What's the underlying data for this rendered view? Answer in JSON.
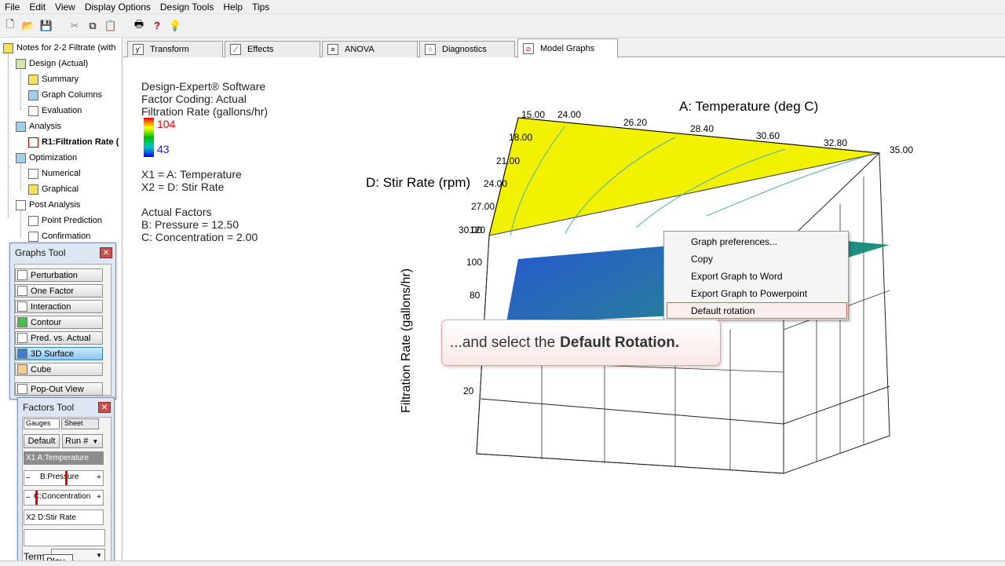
{
  "menu": [
    "File",
    "Edit",
    "View",
    "Display Options",
    "Design Tools",
    "Help",
    "Tips"
  ],
  "toolbar": [
    "new-icon",
    "open-icon",
    "save-icon",
    "cut-icon",
    "copy-icon",
    "paste-icon",
    "print-icon",
    "help-icon",
    "tip-icon"
  ],
  "tree": {
    "root": "Notes for 2-2 Filtrate (with",
    "design": "Design (Actual)",
    "summary": "Summary",
    "graph_columns": "Graph Columns",
    "evaluation": "Evaluation",
    "analysis": "Analysis",
    "r1": "R1:Filtration Rate (",
    "optimization": "Optimization",
    "numerical": "Numerical",
    "graphical": "Graphical",
    "post_analysis": "Post Analysis",
    "point_prediction": "Point Prediction",
    "confirmation": "Confirmation"
  },
  "tabs": [
    "Transform",
    "Effects",
    "ANOVA",
    "Diagnostics",
    "Model Graphs"
  ],
  "active_tab": "Model Graphs",
  "graph_info": {
    "software": "Design-Expert® Software",
    "coding": "Factor Coding: Actual",
    "response": "Filtration Rate (gallons/hr)",
    "high": "104",
    "low": "43",
    "x1": "X1 = A: Temperature",
    "x2": "X2 = D: Stir Rate",
    "actual_factors": "Actual Factors",
    "b": "B: Pressure = 12.50",
    "c": "C: Concentration = 2.00"
  },
  "chart_data": {
    "type": "3d-surface",
    "title_x": "A: Temperature (deg C)",
    "title_y": "D: Stir Rate (rpm)",
    "title_z": "Filtration Rate (gallons/hr)",
    "x_ticks": [
      "24.00",
      "26.20",
      "28.40",
      "30.60",
      "32.80",
      "35.00"
    ],
    "y_ticks": [
      "15.00",
      "18.00",
      "21.00",
      "24.00",
      "27.00",
      "30.00"
    ],
    "z_ticks": [
      "120",
      "100",
      "80",
      "20"
    ],
    "colors": {
      "high": "#ff0000",
      "low": "#0000ff",
      "surface_top": "#f2f200"
    }
  },
  "graphs_tool": {
    "title": "Graphs Tool",
    "buttons": [
      "Perturbation",
      "One Factor",
      "Interaction",
      "Contour",
      "Pred. vs. Actual",
      "3D Surface",
      "Cube"
    ],
    "popout": "Pop-Out View",
    "selected": "3D Surface"
  },
  "factors_tool": {
    "title": "Factors Tool",
    "gauges": "Gauges",
    "sheet": "Sheet",
    "default": "Default",
    "run": "Run #",
    "rows": [
      "X1  A:Temperature",
      "B:Pressure",
      "C:Concentration",
      "X2  D:Stir Rate"
    ],
    "minus": "–",
    "plus": "+",
    "term": "Term",
    "play": "Play"
  },
  "context_menu": {
    "items": [
      "Graph preferences...",
      "Copy",
      "Export Graph to Word",
      "Export Graph to Powerpoint",
      "Default rotation"
    ]
  },
  "callout": {
    "text": "...and select the",
    "bold": "Default Rotation."
  }
}
